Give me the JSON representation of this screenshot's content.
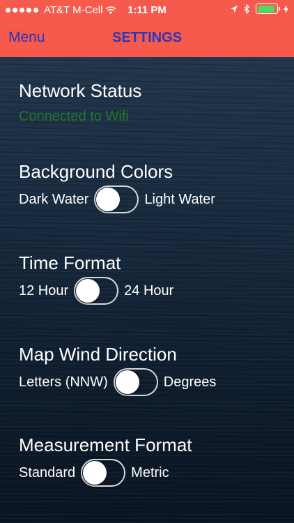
{
  "status_bar": {
    "carrier": "AT&T M-Cell",
    "time": "1:11 PM"
  },
  "nav": {
    "menu_label": "Menu",
    "title": "SETTINGS"
  },
  "network": {
    "title": "Network Status",
    "status": "Connected to Wifi",
    "status_color": "#1f7a24"
  },
  "background_colors": {
    "title": "Background Colors",
    "left_label": "Dark Water",
    "right_label": "Light Water",
    "toggle_on": false
  },
  "time_format": {
    "title": "Time Format",
    "left_label": "12 Hour",
    "right_label": "24 Hour",
    "toggle_on": false
  },
  "wind_direction": {
    "title": "Map Wind Direction",
    "left_label": "Letters (NNW)",
    "right_label": "Degrees",
    "toggle_on": false
  },
  "measurement": {
    "title": "Measurement Format",
    "left_label": "Standard",
    "right_label": "Metric",
    "toggle_on": false
  },
  "colors": {
    "header": "#f65a4c",
    "nav_text": "#2a37b8",
    "battery": "#4cd964"
  },
  "icons": [
    "signal-dots-icon",
    "wifi-icon",
    "location-icon",
    "bluetooth-icon",
    "battery-icon",
    "charging-icon"
  ]
}
